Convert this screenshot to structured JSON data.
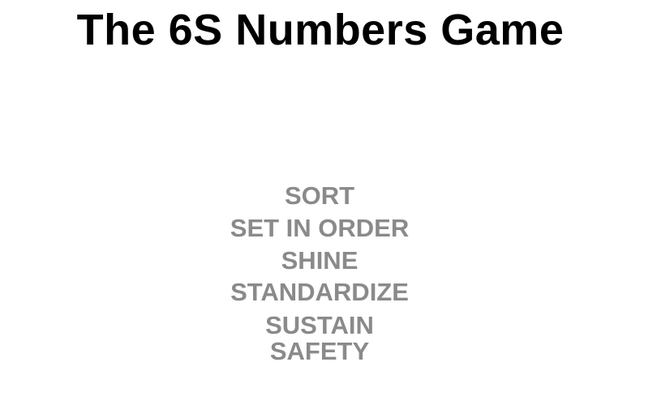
{
  "title": "The 6S Numbers Game",
  "items": [
    "SORT",
    "SET IN ORDER",
    "SHINE",
    "STANDARDIZE",
    "SUSTAIN",
    "SAFETY"
  ],
  "colors": {
    "title": "#000000",
    "items": "#8a8a8a",
    "background": "#ffffff"
  }
}
